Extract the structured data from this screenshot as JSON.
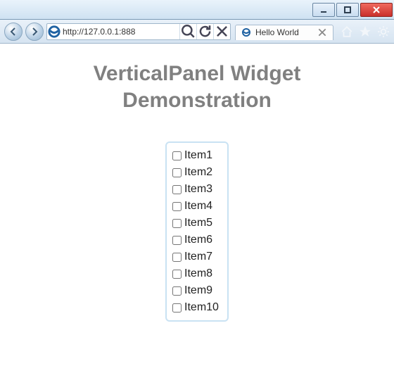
{
  "window": {
    "minimize_hint": "Minimize",
    "maximize_hint": "Maximize",
    "close_hint": "Close"
  },
  "nav": {
    "back_hint": "Back",
    "forward_hint": "Forward",
    "url": "http://127.0.0.1:888",
    "search_hint": "Search",
    "refresh_hint": "Refresh",
    "stop_hint": "Stop"
  },
  "tab": {
    "title": "Hello World",
    "close_hint": "Close Tab"
  },
  "tools": {
    "home_hint": "Home",
    "favorites_hint": "Favorites",
    "settings_hint": "Tools"
  },
  "page": {
    "heading": "VerticalPanel Widget Demonstration",
    "items": [
      {
        "label": "Item1",
        "checked": false
      },
      {
        "label": "Item2",
        "checked": false
      },
      {
        "label": "Item3",
        "checked": false
      },
      {
        "label": "Item4",
        "checked": false
      },
      {
        "label": "Item5",
        "checked": false
      },
      {
        "label": "Item6",
        "checked": false
      },
      {
        "label": "Item7",
        "checked": false
      },
      {
        "label": "Item8",
        "checked": false
      },
      {
        "label": "Item9",
        "checked": false
      },
      {
        "label": "Item10",
        "checked": false
      }
    ]
  }
}
